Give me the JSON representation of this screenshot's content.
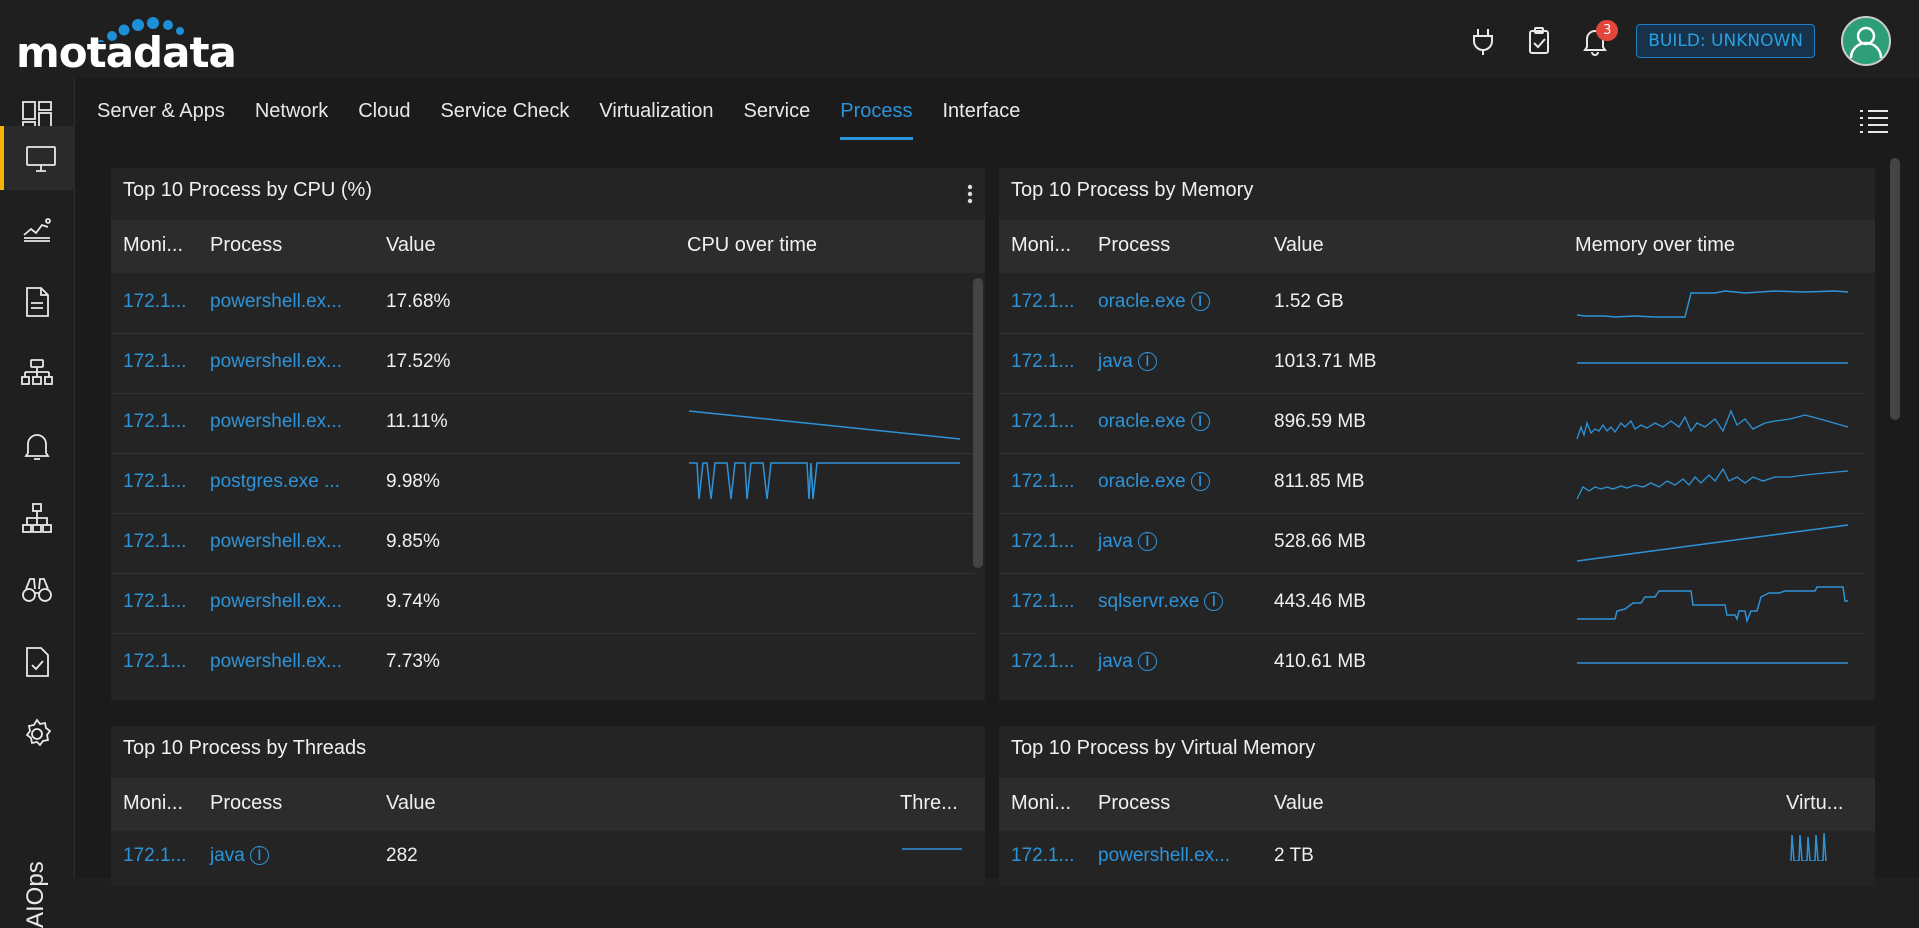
{
  "brand": {
    "name": "motadata"
  },
  "topbar": {
    "notifications_count": "3",
    "build_label": "BUILD: UNKNOWN"
  },
  "sidebar": {
    "items": [
      {
        "icon": "dashboard-icon"
      },
      {
        "icon": "monitor-icon",
        "active": true
      },
      {
        "icon": "metric-explorer-icon"
      },
      {
        "icon": "report-icon"
      },
      {
        "icon": "topology-icon"
      },
      {
        "icon": "alert-bell-icon"
      },
      {
        "icon": "network-map-icon"
      },
      {
        "icon": "binoculars-icon"
      },
      {
        "icon": "audit-icon"
      },
      {
        "icon": "settings-icon"
      }
    ],
    "aiops_label": "AIOps"
  },
  "tabs": [
    {
      "label": "Server & Apps"
    },
    {
      "label": "Network"
    },
    {
      "label": "Cloud"
    },
    {
      "label": "Service Check"
    },
    {
      "label": "Virtualization"
    },
    {
      "label": "Service"
    },
    {
      "label": "Process",
      "active": true
    },
    {
      "label": "Interface"
    }
  ],
  "widgets": {
    "cpu": {
      "title": "Top 10 Process by CPU (%)",
      "columns": [
        "Moni...",
        "Process",
        "Value",
        "CPU over time"
      ],
      "rows": [
        {
          "monitor": "172.1...",
          "process": "powershell.ex...",
          "value": "17.68%"
        },
        {
          "monitor": "172.1...",
          "process": "powershell.ex...",
          "value": "17.52%"
        },
        {
          "monitor": "172.1...",
          "process": "powershell.ex...",
          "value": "11.11%"
        },
        {
          "monitor": "172.1...",
          "process": "postgres.exe ...",
          "value": "9.98%"
        },
        {
          "monitor": "172.1...",
          "process": "powershell.ex...",
          "value": "9.85%"
        },
        {
          "monitor": "172.1...",
          "process": "powershell.ex...",
          "value": "9.74%"
        },
        {
          "monitor": "172.1...",
          "process": "powershell.ex...",
          "value": "7.73%"
        }
      ]
    },
    "memory": {
      "title": "Top 10 Process by Memory",
      "columns": [
        "Moni...",
        "Process",
        "Value",
        "Memory over time"
      ],
      "rows": [
        {
          "monitor": "172.1...",
          "process": "oracle.exe",
          "value": "1.52 GB"
        },
        {
          "monitor": "172.1...",
          "process": "java",
          "value": "1013.71 MB"
        },
        {
          "monitor": "172.1...",
          "process": "oracle.exe",
          "value": "896.59 MB"
        },
        {
          "monitor": "172.1...",
          "process": "oracle.exe",
          "value": "811.85 MB"
        },
        {
          "monitor": "172.1...",
          "process": "java",
          "value": "528.66 MB"
        },
        {
          "monitor": "172.1...",
          "process": "sqlservr.exe",
          "value": "443.46 MB"
        },
        {
          "monitor": "172.1...",
          "process": "java",
          "value": "410.61 MB"
        }
      ]
    },
    "threads": {
      "title": "Top 10 Process by Threads",
      "columns": [
        "Moni...",
        "Process",
        "Value",
        "Thre..."
      ],
      "rows": [
        {
          "monitor": "172.1...",
          "process": "java",
          "value": "282"
        }
      ]
    },
    "virtual_memory": {
      "title": "Top 10 Process by Virtual Memory",
      "columns": [
        "Moni...",
        "Process",
        "Value",
        "Virtu..."
      ],
      "rows": [
        {
          "monitor": "172.1...",
          "process": "powershell.ex...",
          "value": "2 TB"
        }
      ]
    }
  },
  "colors": {
    "accent": "#2d93d8",
    "active_marker": "#f2b705",
    "badge": "#e2453c"
  }
}
